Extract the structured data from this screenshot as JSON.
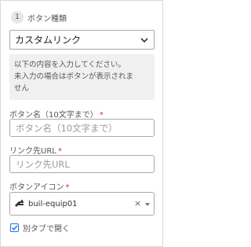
{
  "section": {
    "step": "1",
    "title": "ボタン種類"
  },
  "button_type": {
    "value": "カスタムリンク"
  },
  "info": {
    "line1": "以下の内容を入力してください。",
    "line2": "未入力の場合はボタンが表示されま",
    "line3": "せん"
  },
  "button_name": {
    "label": "ボタン名（10文字まで）",
    "required_mark": "*",
    "value": "",
    "placeholder": "ボタン名（10文字まで）"
  },
  "link_url": {
    "label": "リンク先URL",
    "required_mark": "*",
    "value": "",
    "placeholder": "リンク先URL"
  },
  "button_icon": {
    "label": "ボタンアイコン",
    "required_mark": "*",
    "value": "buil-equip01",
    "icon": "equipment-icon",
    "clear": "×"
  },
  "new_tab": {
    "checked": true,
    "label": "別タブで開く"
  },
  "colors": {
    "required": "#d32f2f",
    "checkbox": "#1a73e8",
    "info_bg": "#f0f0f0"
  }
}
